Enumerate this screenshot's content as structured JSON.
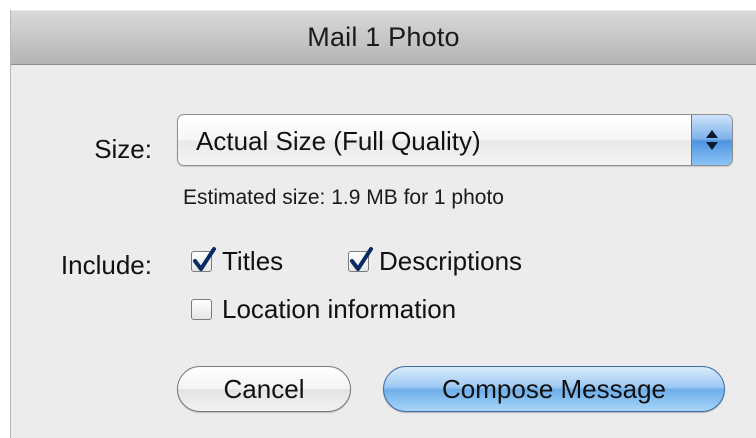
{
  "dialog": {
    "title": "Mail 1 Photo"
  },
  "size": {
    "label": "Size:",
    "selected": "Actual Size (Full Quality)",
    "estimate": "Estimated size: 1.9 MB for 1 photo"
  },
  "include": {
    "label": "Include:",
    "options": [
      {
        "label": "Titles",
        "checked": true
      },
      {
        "label": "Descriptions",
        "checked": true
      },
      {
        "label": "Location information",
        "checked": false
      }
    ]
  },
  "buttons": {
    "cancel": "Cancel",
    "compose": "Compose Message"
  },
  "colors": {
    "default_button": "#6eaeea",
    "checkmark": "#0a2a66"
  },
  "icons": {
    "popup_arrows": "updown-arrows-icon",
    "check": "checkmark-icon"
  }
}
